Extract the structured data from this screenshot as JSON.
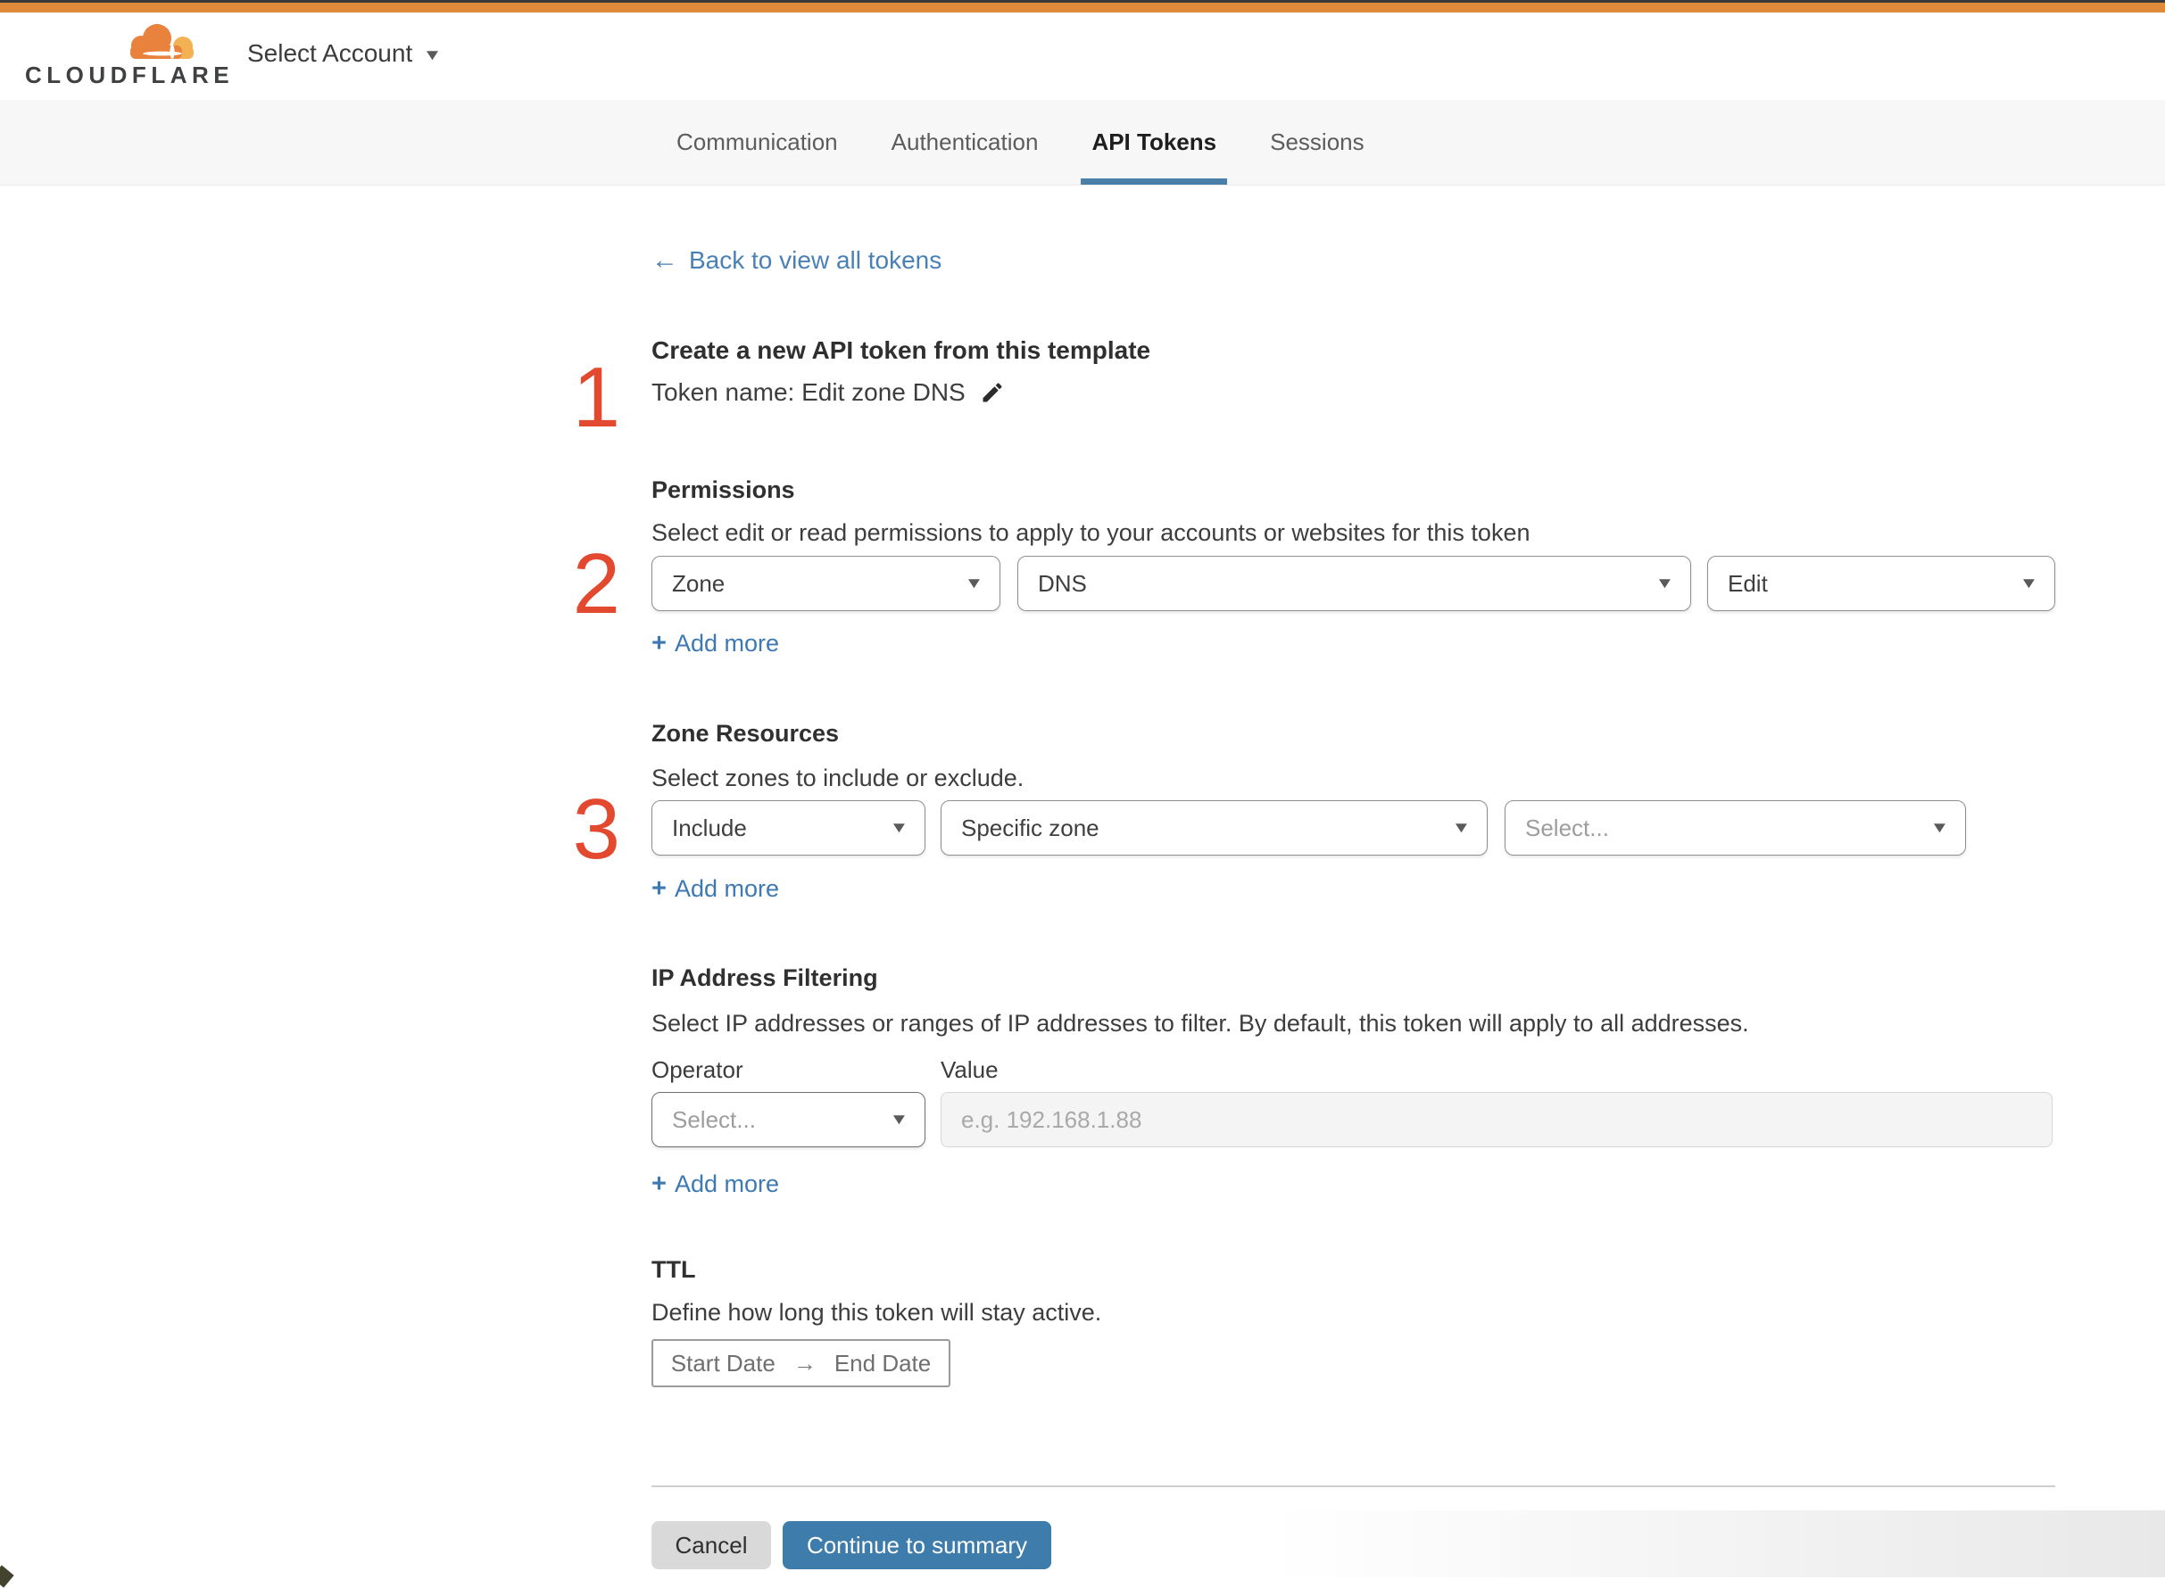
{
  "header": {
    "logo_text": "CLOUDFLARE",
    "account_selector_label": "Select Account"
  },
  "tabs": {
    "items": [
      {
        "label": "Communication",
        "active": false
      },
      {
        "label": "Authentication",
        "active": false
      },
      {
        "label": "API Tokens",
        "active": true
      },
      {
        "label": "Sessions",
        "active": false
      }
    ]
  },
  "content": {
    "back_link_label": "Back to view all tokens",
    "step_numbers": [
      "1",
      "2",
      "3"
    ],
    "create_section": {
      "title": "Create a new API token from this template",
      "token_name": "Token name: Edit zone DNS"
    },
    "permissions": {
      "heading": "Permissions",
      "description": "Select edit or read permissions to apply to your accounts or websites for this token",
      "selects": [
        "Zone",
        "DNS",
        "Edit"
      ],
      "add_more_label": "Add more"
    },
    "zone_resources": {
      "heading": "Zone Resources",
      "description": "Select zones to include or exclude.",
      "selects": [
        "Include",
        "Specific zone"
      ],
      "placeholder_option": "Select...",
      "add_more_label": "Add more"
    },
    "ip_filtering": {
      "heading": "IP Address Filtering",
      "description": "Select IP addresses or ranges of IP addresses to filter. By default, this token will apply to all addresses.",
      "operator_label": "Operator",
      "value_label": "Value",
      "operator_placeholder": "Select...",
      "value_placeholder": "e.g. 192.168.1.88",
      "add_more_label": "Add more"
    },
    "ttl": {
      "heading": "TTL",
      "description": "Define how long this token will stay active.",
      "start_label": "Start Date",
      "end_label": "End Date"
    },
    "footer": {
      "cancel_label": "Cancel",
      "continue_label": "Continue to summary"
    }
  },
  "icons": {
    "plus": "+",
    "caret_down": "▼",
    "arrow_left": "←",
    "arrow_right": "→",
    "pencil": "edit-pencil",
    "cloud_logo": "cloudflare-cloud"
  },
  "colors": {
    "brand_orange": "#DF8A3B",
    "top_strip_dark": "#3B3B3B",
    "link_blue": "#4A81B5",
    "add_more_blue": "#3D79B3",
    "primary_button_blue": "#3E7CAB",
    "cancel_button_gray": "#D9D9D9",
    "tab_underline_blue": "#4A80A8",
    "tabbar_background": "#F7F7F8",
    "step_number_red": "#E2492F"
  }
}
